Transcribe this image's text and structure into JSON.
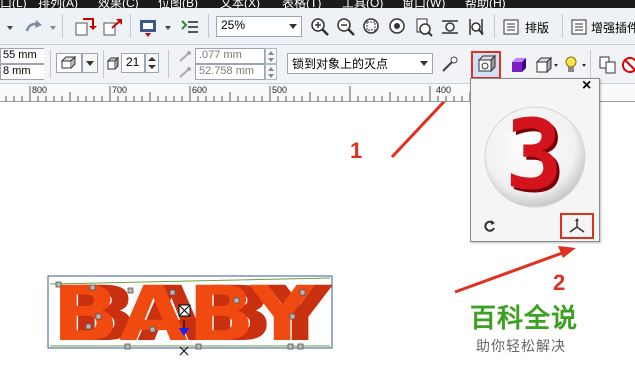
{
  "menubar": {
    "items": [
      "口(L)",
      "排列(A)",
      "效果(C)",
      "位图(B)",
      "文本(X)",
      "表格(T)",
      "工具(O)",
      "窗口(W)",
      "帮助(H)"
    ]
  },
  "toolbar1": {
    "zoom_value": "25%",
    "layout_label": "排版",
    "enhance_label": "增强插件"
  },
  "toolbar2": {
    "width_value": "55 mm",
    "height_value": "8 mm",
    "angle_value": "21",
    "outline_width": ".077 mm",
    "offset_value": "52.758 mm",
    "snap_option": "锁到对象上的灭点"
  },
  "ruler": {
    "labels": [
      "800",
      "700",
      "600",
      "500",
      "400"
    ]
  },
  "canvas": {
    "artwork_text": "BABY",
    "annotation_1": "1",
    "annotation_2": "2",
    "watermark_title": "百科全说",
    "watermark_subtitle": "助你轻松解决"
  },
  "popup": {
    "preview_glyph": "3",
    "close_label": "×"
  },
  "colors": {
    "accent_red": "#e0301e",
    "artwork_orange": "#f04a10",
    "watermark_green": "#3ca020"
  }
}
